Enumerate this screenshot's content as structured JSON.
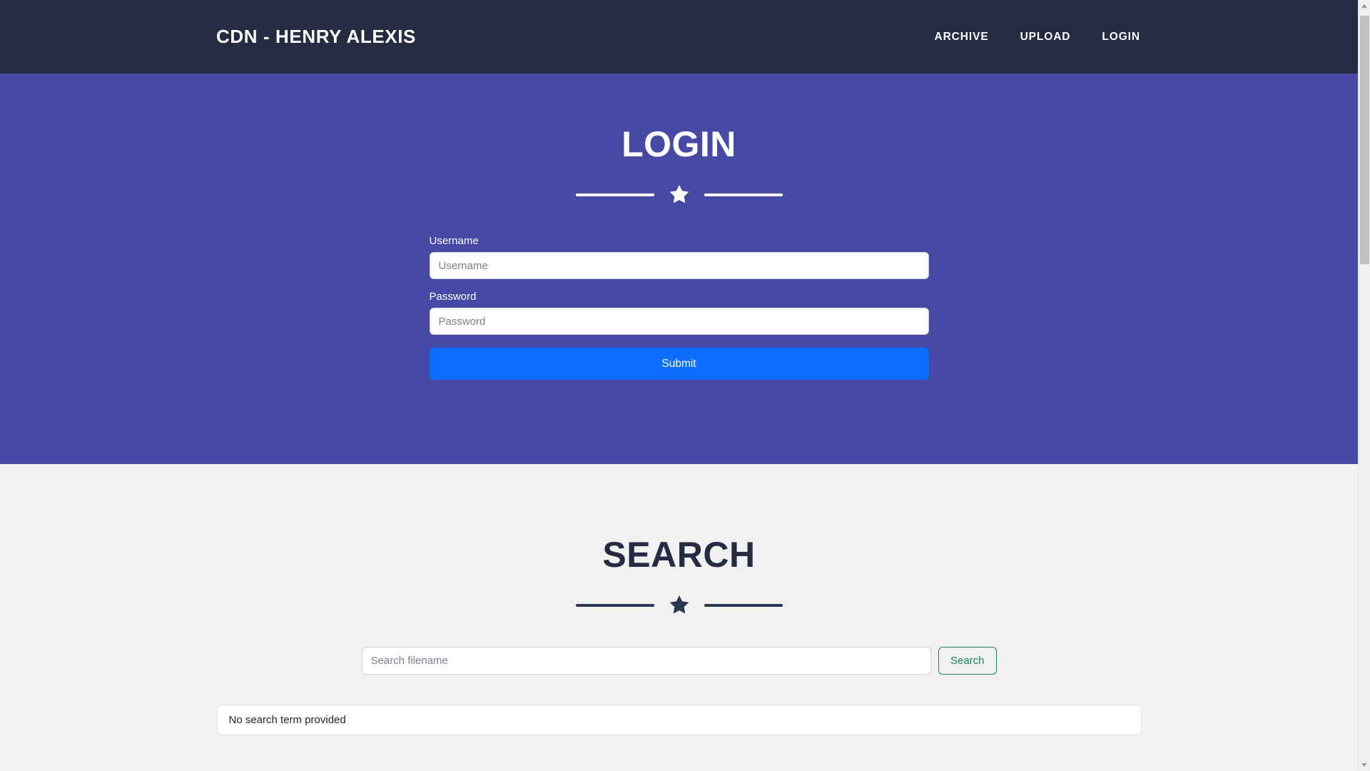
{
  "navbar": {
    "brand": "CDN - HENRY ALEXIS",
    "links": [
      {
        "label": "ARCHIVE"
      },
      {
        "label": "UPLOAD"
      },
      {
        "label": "LOGIN"
      }
    ]
  },
  "hero": {
    "title": "LOGIN",
    "divider_icon": "star-icon",
    "form": {
      "username": {
        "label": "Username",
        "placeholder": "Username",
        "value": ""
      },
      "password": {
        "label": "Password",
        "placeholder": "Password",
        "value": ""
      },
      "submit_label": "Submit"
    }
  },
  "search": {
    "title": "SEARCH",
    "divider_icon": "star-icon",
    "input": {
      "placeholder": "Search filename",
      "value": ""
    },
    "button_label": "Search",
    "results": [
      {
        "text": "No search term provided"
      }
    ]
  },
  "colors": {
    "navbar_bg": "#252b42",
    "hero_bg": "#464aa4",
    "page_bg": "#f1f1f1",
    "primary": "#0d6efd",
    "success": "#198754",
    "heading_dark": "#252b42"
  }
}
